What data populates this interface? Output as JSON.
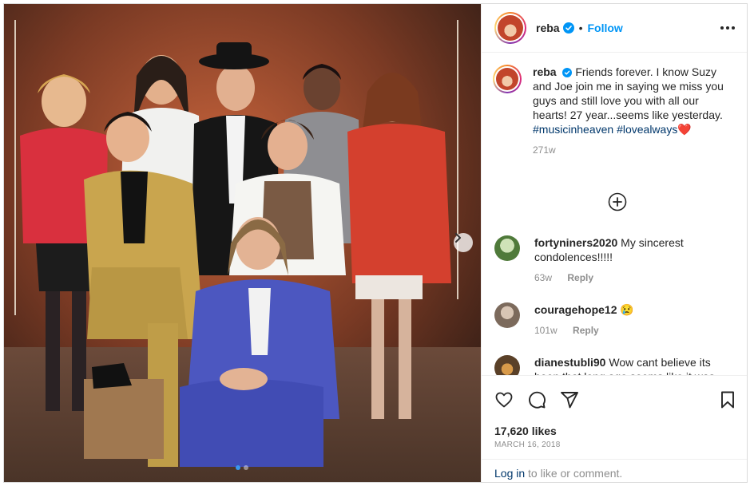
{
  "post": {
    "username": "reba",
    "follow_label": "Follow",
    "dot_separator": "•",
    "verified_icon": "verified-badge-icon",
    "more_icon": "more-options-icon"
  },
  "caption": {
    "username": "reba",
    "text": "Friends forever. I know Suzy and Joe join me in saying we miss you guys and still love you with all our hearts! 27 year...seems like yesterday.",
    "hashtag1": "#musicinheaven",
    "hashtag2": "#lovealways",
    "emoji": "❤️",
    "age": "271w"
  },
  "comments": [
    {
      "username": "fortyniners2020",
      "text": "My sincerest condolences!!!!!",
      "age": "63w",
      "reply_label": "Reply"
    },
    {
      "username": "couragehope12",
      "text": "😢",
      "age": "101w",
      "reply_label": "Reply"
    },
    {
      "username": "dianestubli90",
      "text": "Wow cant believe its been that long ago seems like it was"
    }
  ],
  "footer": {
    "likes": "17,620 likes",
    "date": "MARCH 16, 2018",
    "login_link": "Log in",
    "login_rest": " to like or comment."
  },
  "carousel": {
    "slide_count": 2,
    "active_index": 0
  },
  "colors": {
    "accent": "#0095f6",
    "hashtag": "#00376b",
    "muted": "#8e8e8e",
    "active_dot": "#3897f0"
  }
}
